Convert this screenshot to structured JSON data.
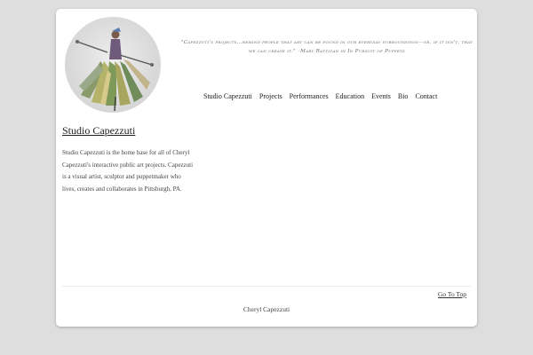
{
  "header": {
    "logo_alt": "puppet-figure-logo",
    "quote_text": "\"Capezzuti's projects...remind people that art can be found in our everyday surroundings—or, if it isn't, that we can create it.\" –Mary Rattigan in In Pursuit of Puppets"
  },
  "nav": {
    "items": [
      {
        "label": "Studio Capezzuti"
      },
      {
        "label": "Projects"
      },
      {
        "label": "Performances"
      },
      {
        "label": "Education"
      },
      {
        "label": "Events"
      },
      {
        "label": "Bio"
      },
      {
        "label": "Contact"
      }
    ]
  },
  "main": {
    "title": "Studio Capezzuti",
    "intro": "Studio Capezzuti is the home base for all of Cheryl Capezzuti's interactive public art projects. Capezzuti is a visual artist, sculptor and puppetmaker who lives, creates and collaborates in Pittsburgh, PA."
  },
  "footer": {
    "go_to_top": "Go To Top",
    "credit": "Cheryl Capezzuti"
  }
}
